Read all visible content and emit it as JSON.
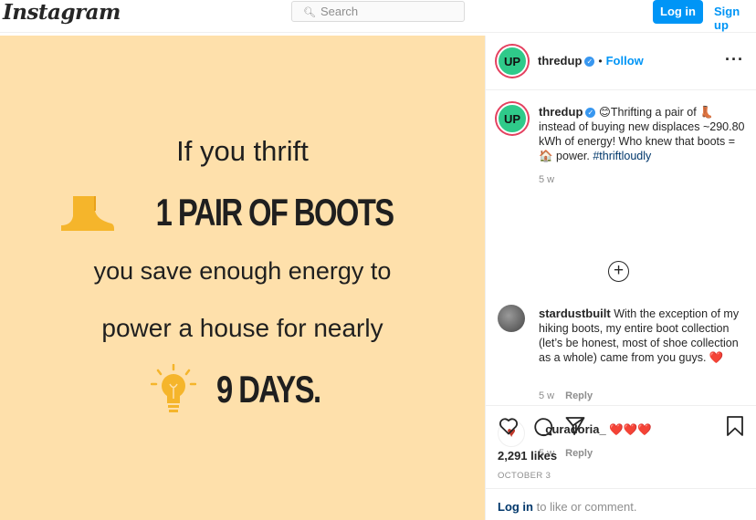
{
  "nav": {
    "logo": "Instagram",
    "search_placeholder": "Search",
    "login_label": "Log in",
    "signup_label": "Sign up"
  },
  "post_image": {
    "line1": "If you thrift",
    "line2": "1 PAIR OF BOOTS",
    "line3": "you save enough energy to",
    "line4": "power a house for nearly",
    "line5": "9 DAYS.",
    "boot_color": "#f5b52b",
    "background": "#fee0ab"
  },
  "header": {
    "avatar_text": "UP",
    "username": "thredup",
    "follow_label": "Follow"
  },
  "caption": {
    "username": "thredup",
    "text_before": "😊Thrifting a pair of 👢 instead of buying new displaces ~290.80 kWh of energy! Who knew that boots = 🏠 power. ",
    "hashtag": "#thriftloudly",
    "time": "5 w"
  },
  "comments": [
    {
      "username": "stardustbuilt",
      "text": "With the exception of my hiking boots, my entire boot collection (let’s be honest, most of shoe collection as a whole) came from you guys. ❤️",
      "time": "5 w",
      "reply": "Reply"
    },
    {
      "username": "_curadoria_",
      "text": "❤️❤️❤️",
      "time": "5 w",
      "reply": "Reply"
    }
  ],
  "engagement": {
    "likes": "2,291 likes",
    "date": "OCTOBER 3",
    "login_link": "Log in",
    "login_rest": " to like or comment."
  }
}
